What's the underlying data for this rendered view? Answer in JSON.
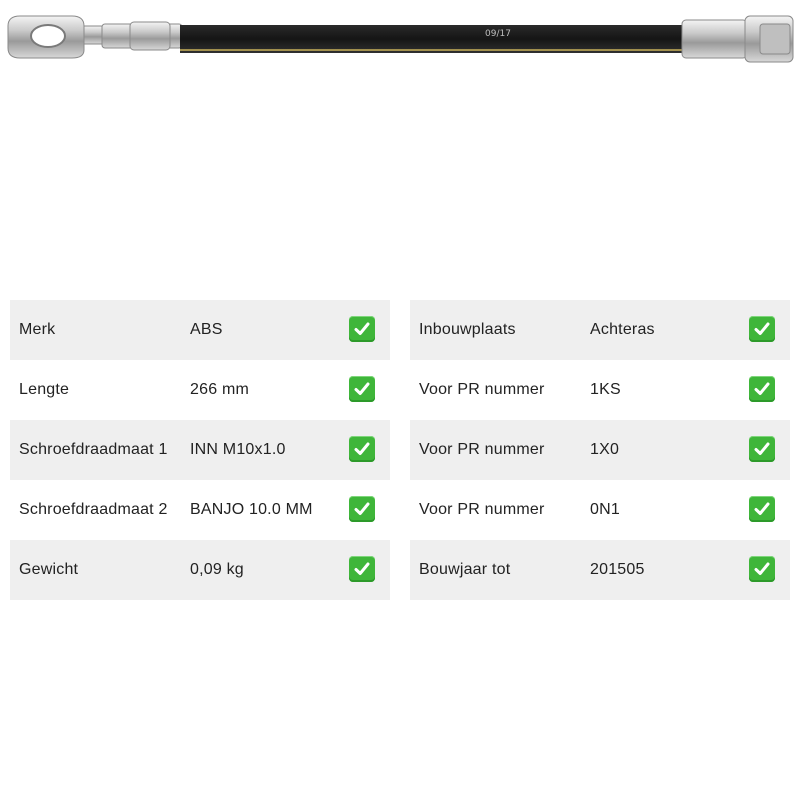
{
  "product": {
    "image_name": "brake-hose",
    "hose_marking": "09/17"
  },
  "colors": {
    "check_green": "#3fb63a",
    "row_shade": "#efefef"
  },
  "left_table": [
    {
      "label": "Merk",
      "value": "ABS",
      "status_icon": "check-icon"
    },
    {
      "label": "Lengte",
      "value": "266 mm",
      "status_icon": "check-icon"
    },
    {
      "label": "Schroefdraadmaat 1",
      "value": "INN M10x1.0",
      "status_icon": "check-icon"
    },
    {
      "label": "Schroefdraadmaat 2",
      "value": "BANJO 10.0 MM",
      "status_icon": "check-icon"
    },
    {
      "label": "Gewicht",
      "value": "0,09 kg",
      "status_icon": "check-icon"
    }
  ],
  "right_table": [
    {
      "label": "Inbouwplaats",
      "value": "Achteras",
      "status_icon": "check-icon"
    },
    {
      "label": "Voor PR nummer",
      "value": "1KS",
      "status_icon": "check-icon"
    },
    {
      "label": "Voor PR nummer",
      "value": "1X0",
      "status_icon": "check-icon"
    },
    {
      "label": "Voor PR nummer",
      "value": "0N1",
      "status_icon": "check-icon"
    },
    {
      "label": "Bouwjaar tot",
      "value": "201505",
      "status_icon": "check-icon"
    }
  ]
}
